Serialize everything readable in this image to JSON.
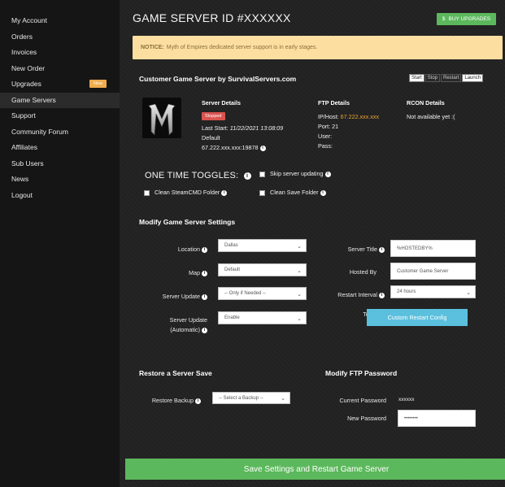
{
  "sidebar": {
    "items": [
      {
        "label": "My Account"
      },
      {
        "label": "Orders"
      },
      {
        "label": "Invoices"
      },
      {
        "label": "New Order"
      },
      {
        "label": "Upgrades",
        "badge": "New"
      },
      {
        "label": "Game Servers"
      },
      {
        "label": "Support"
      },
      {
        "label": "Community Forum"
      },
      {
        "label": "Affiliates"
      },
      {
        "label": "Sub Users"
      },
      {
        "label": "News"
      },
      {
        "label": "Logout"
      }
    ],
    "active": "Game Servers"
  },
  "header": {
    "title": "GAME SERVER ID #XXXXXX",
    "upgrades_button": "BUY UPGRADES"
  },
  "notice": {
    "label": "NOTICE:",
    "text": "Myth of Empires dedicated server support is in early stages."
  },
  "server": {
    "section_title": "Customer Game Server by SurvivalServers.com",
    "controls": [
      "Start",
      "Stop",
      "Restart",
      "Launch"
    ],
    "details_title": "Server Details",
    "status": "Stopped",
    "last_start_label": "Last Start:",
    "last_start_value": "11/22/2021 13:08:09",
    "name": "Default",
    "address": "67.222.xxx.xxx:19878",
    "ftp": {
      "title": "FTP Details",
      "host_label": "IP/Host:",
      "host_value": "67.222.xxx.xxx",
      "port": "Port: 21",
      "user": "User:",
      "pass": "Pass:"
    },
    "rcon": {
      "title": "RCON Details",
      "text": "Not available yet :("
    }
  },
  "toggles": {
    "title": "ONE TIME TOGGLES:",
    "skip_updating": "Skip server updating",
    "clean_steamcmd": "Clean SteamCMD Folder",
    "clean_save": "Clean Save Folder"
  },
  "settings": {
    "title": "Modify Game Server Settings",
    "location_label": "Location",
    "location_value": "Dallas",
    "map_label": "Map",
    "map_value": "Default",
    "update_label": "Server Update",
    "update_value": "-- Only if Needed --",
    "auto_update_label_1": "Server Update",
    "auto_update_label_2": "(Automatic)",
    "auto_update_value": "Enable",
    "server_title_label": "Server Title",
    "server_title_value": "%HOSTEDBY%",
    "hosted_by_label": "Hosted By",
    "hosted_by_value": "Customer Game Server",
    "restart_interval_label": "Restart Interval",
    "restart_interval_value": "24 hours",
    "tools_label": "Tools",
    "custom_restart_button": "Custom Restart Config"
  },
  "restore": {
    "title": "Restore a Server Save",
    "label": "Restore Backup",
    "select_placeholder": "-- Select a Backup --"
  },
  "ftp_password": {
    "title": "Modify FTP Password",
    "current_label": "Current Password",
    "current_value": "xxxxxx",
    "new_label": "New Password",
    "new_value": "••••••••"
  },
  "footer": {
    "save_button": "Save Settings and Restart Game Server"
  },
  "colors": {
    "green": "#5cb85c",
    "red": "#d9534f",
    "notice_bg": "#fcdfa0",
    "info": "#5bc0de",
    "orange": "#e8a532"
  }
}
